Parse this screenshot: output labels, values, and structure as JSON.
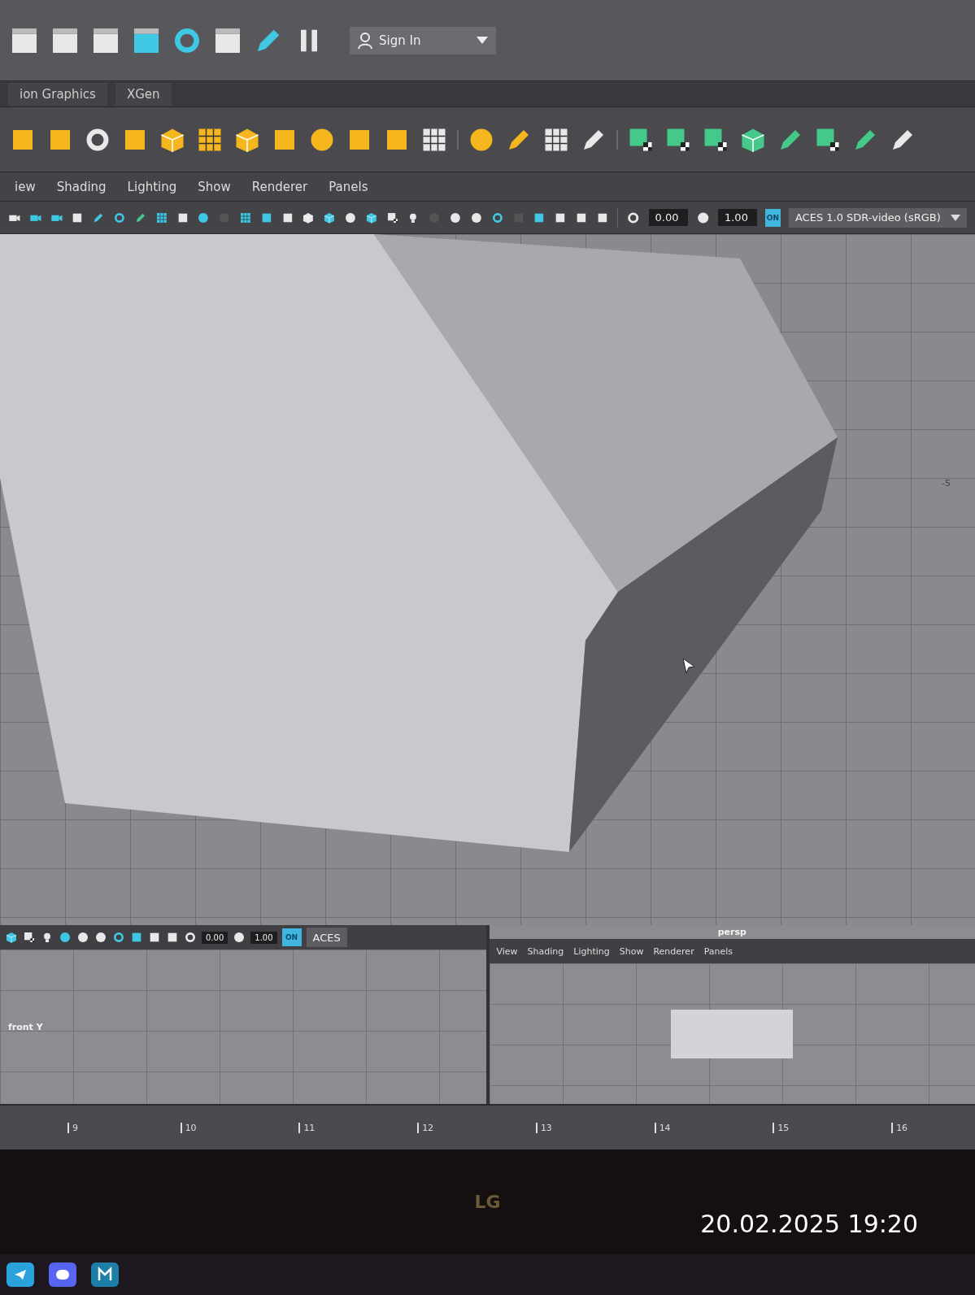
{
  "status_line": {
    "sign_in": "Sign In"
  },
  "shelf_tabs": [
    "ion Graphics",
    "XGen"
  ],
  "panel_menu": [
    "iew",
    "Shading",
    "Lighting",
    "Show",
    "Renderer",
    "Panels"
  ],
  "panel_toolbar": {
    "exposure": "0.00",
    "gamma": "1.00",
    "color_management": "ON",
    "view_transform": "ACES 1.0 SDR-video (sRGB)"
  },
  "viewport": {
    "grid_label": "-5"
  },
  "lower_left_pane": {
    "exposure": "0.00",
    "gamma": "1.00",
    "color_management": "ON",
    "view_transform": "ACES"
  },
  "lower_right_pane": {
    "camera": "persp",
    "menu": [
      "View",
      "Shading",
      "Lighting",
      "Show",
      "Renderer",
      "Panels"
    ]
  },
  "front_pane": {
    "camera": "front Y"
  },
  "timeline": {
    "ticks": [
      "9",
      "10",
      "11",
      "12",
      "13",
      "14",
      "15",
      "16"
    ]
  },
  "monitor": {
    "brand": "LG"
  },
  "photo_timestamp": "20.02.2025 19:20"
}
